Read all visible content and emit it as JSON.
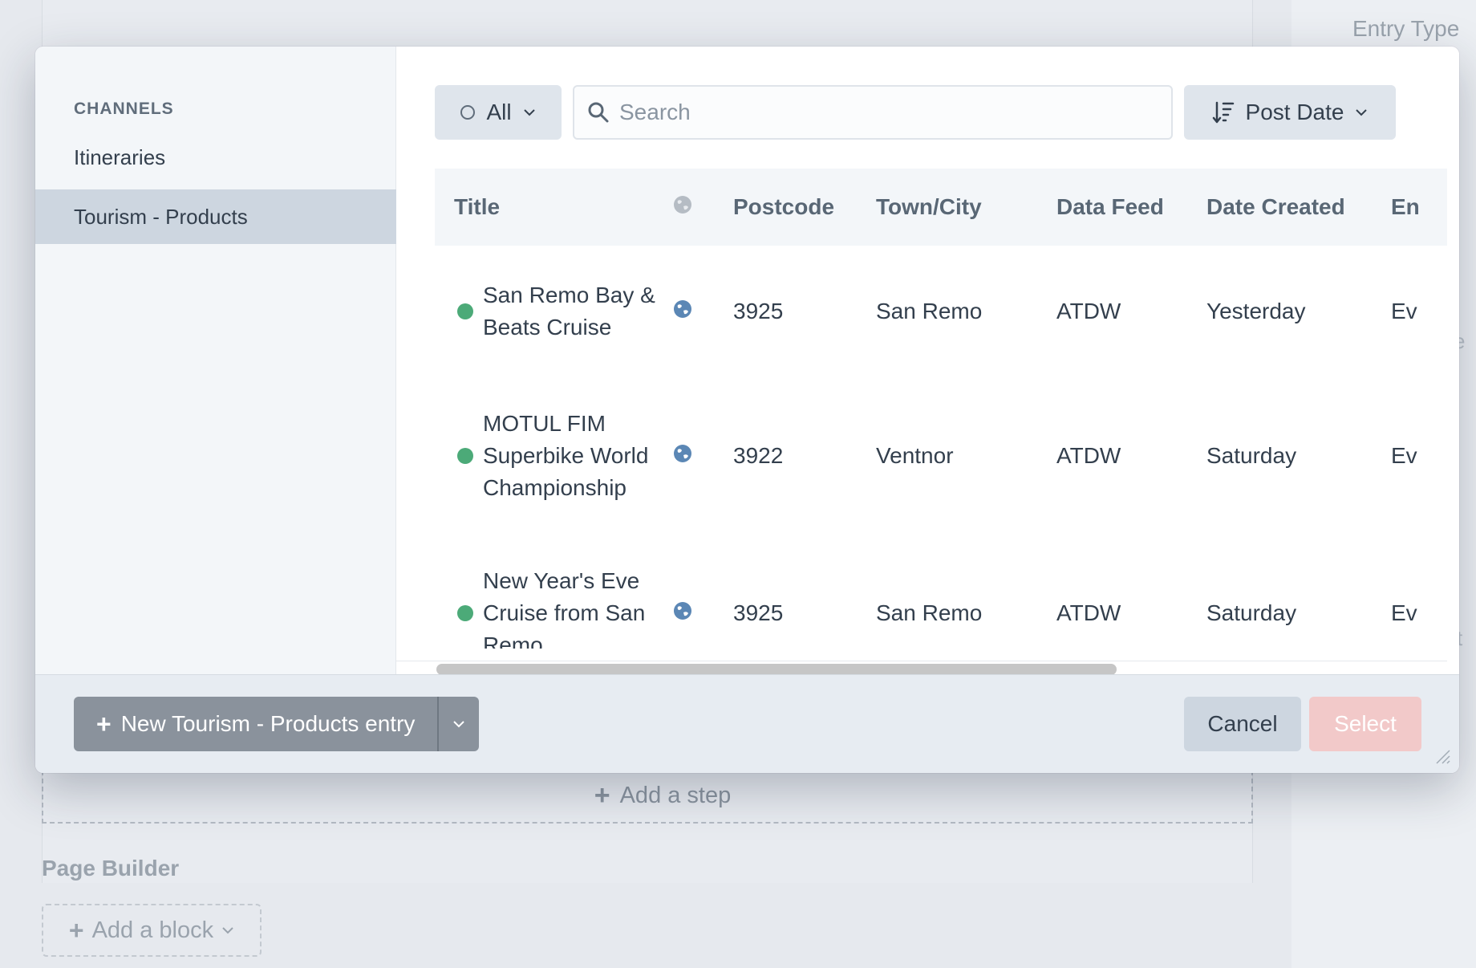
{
  "background": {
    "sidebar_label": "Entry Type",
    "add_step_label": "Add a step",
    "page_builder_label": "Page Builder",
    "add_block_label": "Add a block",
    "right_edge_fragments": [
      "e",
      "t"
    ]
  },
  "modal": {
    "sidebar": {
      "heading": "CHANNELS",
      "items": [
        {
          "label": "Itineraries",
          "active": false
        },
        {
          "label": "Tourism - Products",
          "active": true
        }
      ]
    },
    "toolbar": {
      "status_label": "All",
      "search": {
        "placeholder": "Search",
        "value": ""
      },
      "sort_label": "Post Date"
    },
    "table": {
      "columns": [
        "Title",
        "",
        "Postcode",
        "Town/City",
        "Data Feed",
        "Date Created",
        "En"
      ],
      "rows": [
        {
          "title": "San Remo Bay & Beats Cruise",
          "postcode": "3925",
          "town": "San Remo",
          "feed": "ATDW",
          "date": "Yesterday",
          "extra": "Ev"
        },
        {
          "title": "MOTUL FIM Superbike World Championship",
          "postcode": "3922",
          "town": "Ventnor",
          "feed": "ATDW",
          "date": "Saturday",
          "extra": "Ev"
        },
        {
          "title": "New Year's Eve Cruise from San Remo",
          "postcode": "3925",
          "town": "San Remo",
          "feed": "ATDW",
          "date": "Saturday",
          "extra": "Ev"
        }
      ]
    },
    "footer": {
      "new_entry_label": "New Tourism - Products entry",
      "cancel_label": "Cancel",
      "select_label": "Select"
    }
  },
  "colors": {
    "status_live": "#4caa78",
    "select_disabled": "#f2c9c9",
    "active_sidebar": "#cdd6e0",
    "globe": "#5b87b5"
  },
  "icons": [
    "search-icon",
    "sort-icon",
    "chevron-down-icon",
    "globe-icon",
    "plus-icon",
    "status-ring-icon",
    "resize-handle-icon"
  ]
}
